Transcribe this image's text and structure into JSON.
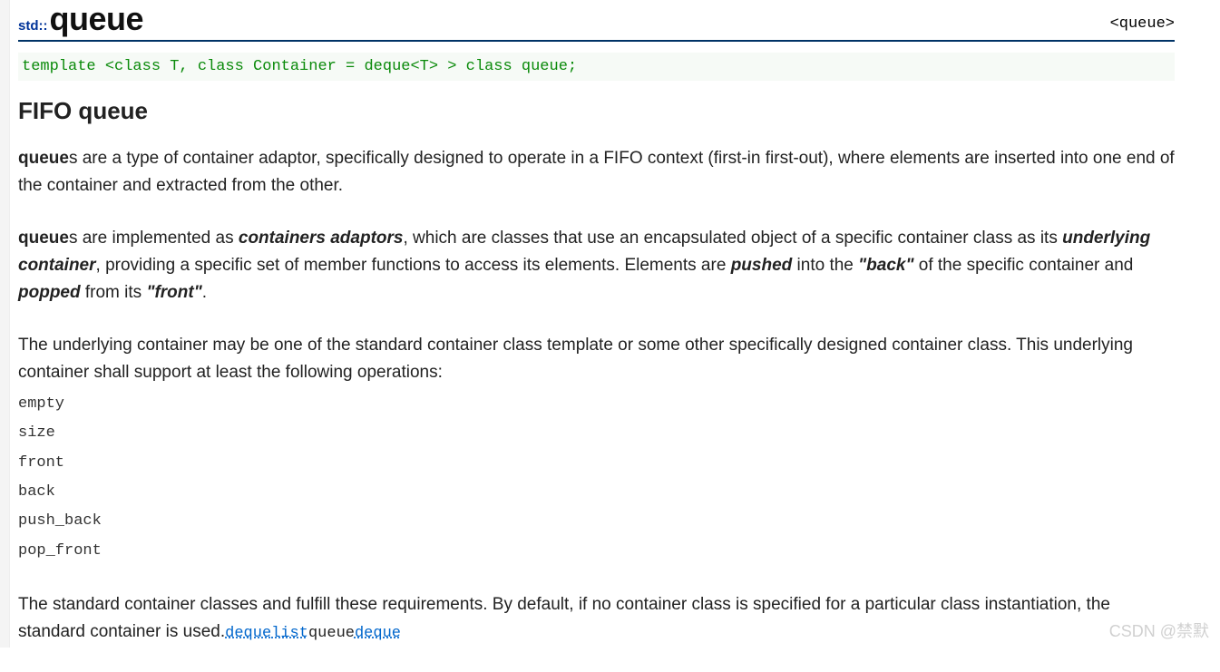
{
  "header": {
    "namespace": "std::",
    "title": "queue",
    "headerfile": "<queue>"
  },
  "template_decl": "template <class T, class Container = deque<T> > class queue;",
  "subtitle": "FIFO queue",
  "p1": {
    "start_bold": "queue",
    "rest": "s are a type of container adaptor, specifically designed to operate in a FIFO context (first-in first-out), where elements are inserted into one end of the container and extracted from the other."
  },
  "p2": {
    "t1_bold": "queue",
    "t2": "s are implemented as ",
    "t3_bi": "containers adaptors",
    "t4": ", which are classes that use an encapsulated object of a specific container class as its ",
    "t5_bi": "underlying container",
    "t6": ", providing a specific set of member functions to access its elements. Elements are ",
    "t7_i": "pushed",
    "t8": " into the ",
    "t9_bi": "\"back\"",
    "t10": " of the specific container and ",
    "t11_i": "popped",
    "t12": " from its ",
    "t13_bi": "\"front\"",
    "t14": "."
  },
  "p3": "The underlying container may be one of the standard container class template or some other specifically designed container class. This underlying container shall support at least the following operations:",
  "ops": [
    "empty",
    "size",
    "front",
    "back",
    "push_back",
    "pop_front"
  ],
  "p4": {
    "t1": "The standard container classes and fulfill these requirements. By default, if no container class is specified for a particular class instantiation, the standard container is used.",
    "l1": "deque",
    "l2": "list",
    "t2": "queue",
    "l3": "deque"
  },
  "watermark": "CSDN @禁默"
}
